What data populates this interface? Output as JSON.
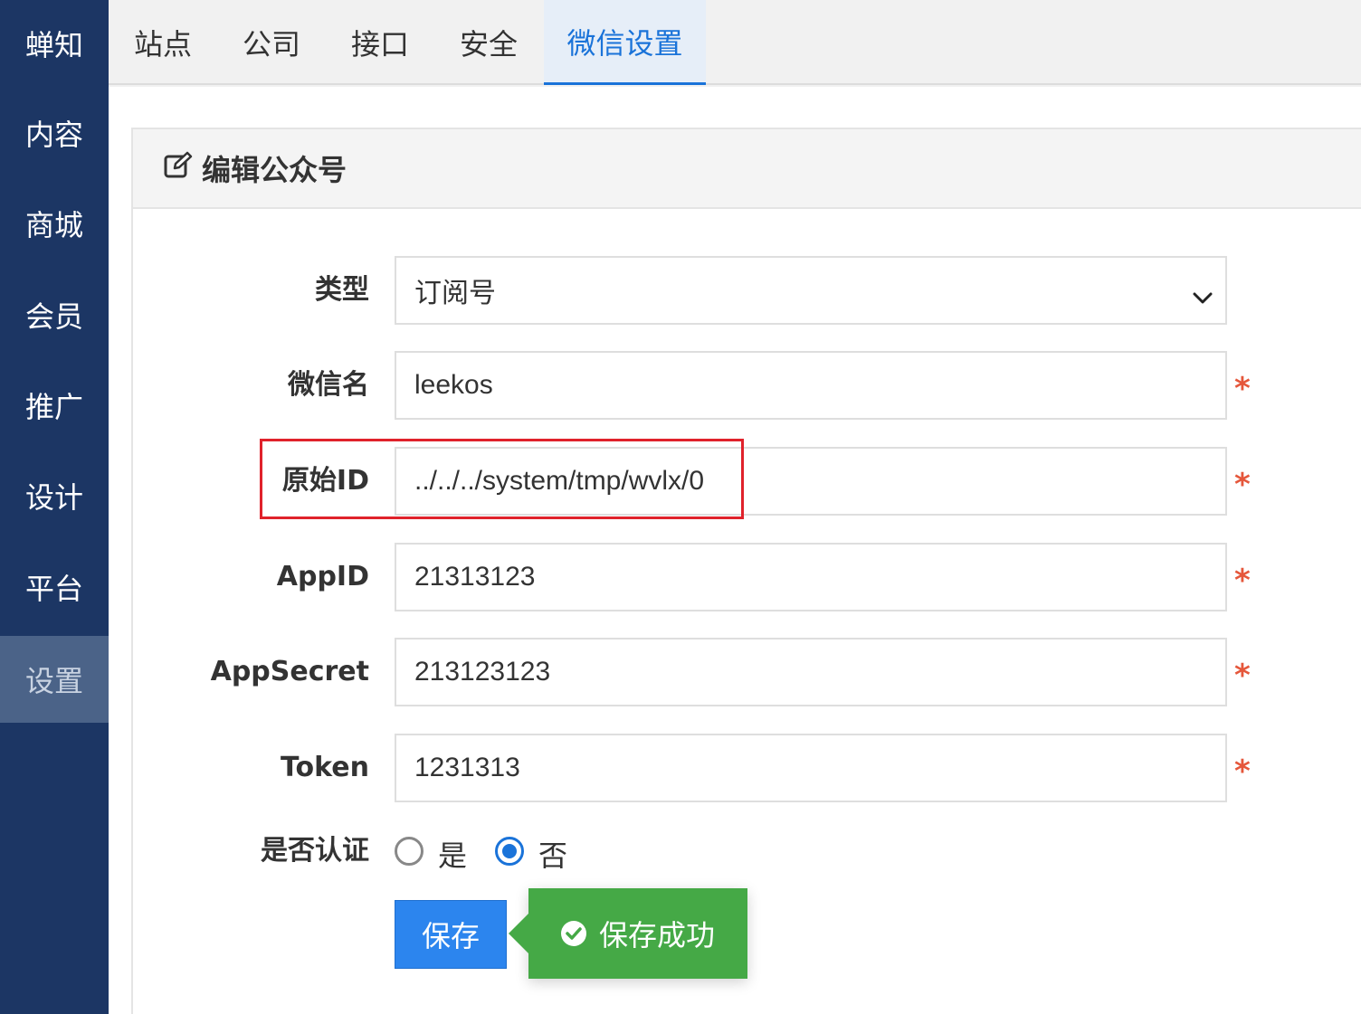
{
  "sidebar": {
    "items": [
      {
        "label": "蝉知"
      },
      {
        "label": "内容"
      },
      {
        "label": "商城"
      },
      {
        "label": "会员"
      },
      {
        "label": "推广"
      },
      {
        "label": "设计"
      },
      {
        "label": "平台"
      },
      {
        "label": "设置",
        "active": true
      }
    ]
  },
  "topnav": {
    "tabs": [
      {
        "label": "站点"
      },
      {
        "label": "公司"
      },
      {
        "label": "接口"
      },
      {
        "label": "安全"
      },
      {
        "label": "微信设置",
        "active": true
      }
    ]
  },
  "panel": {
    "title": "编辑公众号",
    "icon": "edit-icon"
  },
  "form": {
    "type": {
      "label": "类型",
      "value": "订阅号"
    },
    "name": {
      "label": "微信名",
      "value": "leekos",
      "required": "*"
    },
    "original_id": {
      "label": "原始ID",
      "value": "../../../system/tmp/wvlx/0",
      "required": "*"
    },
    "appid": {
      "label": "AppID",
      "value": "21313123",
      "required": "*"
    },
    "appsecret": {
      "label": "AppSecret",
      "value": "213123123",
      "required": "*"
    },
    "token": {
      "label": "Token",
      "value": "1231313",
      "required": "*"
    },
    "certified": {
      "label": "是否认证",
      "options": [
        {
          "label": "是",
          "checked": false
        },
        {
          "label": "否",
          "checked": true
        }
      ]
    },
    "save_label": "保存"
  },
  "toast": {
    "message": "保存成功",
    "color": "#45a946"
  },
  "colors": {
    "sidebar": "#1c3664",
    "accent": "#1a73d9",
    "required": "#e5573b",
    "highlight": "#e0222b"
  }
}
